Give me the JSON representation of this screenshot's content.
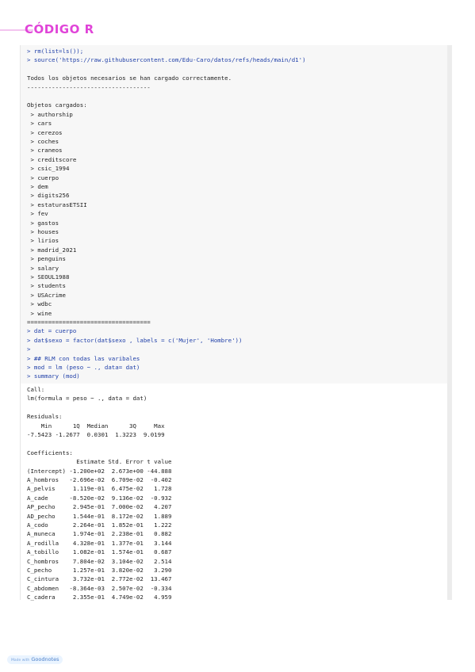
{
  "page": {
    "title": "CÓDIGO R",
    "badge_prefix": "Made with",
    "badge_brand": "Goodnotes"
  },
  "console_lines": [
    {
      "text": "> rm(list=ls());",
      "kind": "cmd"
    },
    {
      "text": "> source('https://raw.githubusercontent.com/Edu-Caro/datos/refs/heads/main/d1')",
      "kind": "cmd"
    },
    {
      "text": "",
      "kind": "out"
    },
    {
      "text": "Todos los objetos necesarios se han cargado correctamente.",
      "kind": "out"
    },
    {
      "text": "-----------------------------------",
      "kind": "out"
    },
    {
      "text": "",
      "kind": "out"
    },
    {
      "text": "Objetos cargados:",
      "kind": "out"
    },
    {
      "text": " > authorship",
      "kind": "out"
    },
    {
      "text": " > cars",
      "kind": "out"
    },
    {
      "text": " > cerezos",
      "kind": "out"
    },
    {
      "text": " > coches",
      "kind": "out"
    },
    {
      "text": " > craneos",
      "kind": "out"
    },
    {
      "text": " > creditscore",
      "kind": "out"
    },
    {
      "text": " > csic_1994",
      "kind": "out"
    },
    {
      "text": " > cuerpo",
      "kind": "out"
    },
    {
      "text": " > dem",
      "kind": "out"
    },
    {
      "text": " > digits256",
      "kind": "out"
    },
    {
      "text": " > estaturasETSII",
      "kind": "out"
    },
    {
      "text": " > fev",
      "kind": "out"
    },
    {
      "text": " > gastos",
      "kind": "out"
    },
    {
      "text": " > houses",
      "kind": "out"
    },
    {
      "text": " > lirios",
      "kind": "out"
    },
    {
      "text": " > madrid_2021",
      "kind": "out"
    },
    {
      "text": " > penguins",
      "kind": "out"
    },
    {
      "text": " > salary",
      "kind": "out"
    },
    {
      "text": " > SEOUL1988",
      "kind": "out"
    },
    {
      "text": " > students",
      "kind": "out"
    },
    {
      "text": " > USAcrime",
      "kind": "out"
    },
    {
      "text": " > wdbc",
      "kind": "out"
    },
    {
      "text": " > wine",
      "kind": "out"
    },
    {
      "text": "===================================",
      "kind": "out"
    },
    {
      "text": "> dat = cuerpo",
      "kind": "cmd"
    },
    {
      "text": "> dat$sexo = factor(dat$sexo , labels = c('Mujer', 'Hombre'))",
      "kind": "cmd"
    },
    {
      "text": ">",
      "kind": "cmd"
    },
    {
      "text": "> ## RLM con todas las varibales",
      "kind": "cmd"
    },
    {
      "text": "> mod = lm (peso ~ ., data= dat)",
      "kind": "cmd"
    },
    {
      "text": "> summary (mod)",
      "kind": "cmd"
    }
  ],
  "output_lines": [
    "Call:",
    "lm(formula = peso ~ ., data = dat)",
    "",
    "Residuals:",
    "    Min      1Q  Median      3Q     Max ",
    "-7.5423 -1.2677  0.0301  1.3223  9.0199 ",
    "",
    "Coefficients:",
    "              Estimate Std. Error t value",
    "(Intercept) -1.200e+02  2.673e+00 -44.888",
    "A_hombros   -2.696e-02  6.709e-02  -0.402",
    "A_pelvis     1.119e-01  6.475e-02   1.728",
    "A_cade      -8.520e-02  9.136e-02  -0.932",
    "AP_pecho     2.945e-01  7.000e-02   4.207",
    "AD_pecho     1.544e-01  8.172e-02   1.889",
    "A_codo       2.264e-01  1.852e-01   1.222",
    "A_muneca     1.974e-01  2.238e-01   0.882",
    "A_rodilla    4.328e-01  1.377e-01   3.144",
    "A_tobillo    1.082e-01  1.574e-01   0.687",
    "C_hombros    7.804e-02  3.104e-02   2.514",
    "C_pecho      1.257e-01  3.820e-02   3.290",
    "C_cintura    3.732e-01  2.772e-02  13.467",
    "C_abdomen   -8.364e-03  2.507e-02  -0.334",
    "C_cadera     2.355e-01  4.749e-02   4.959"
  ]
}
